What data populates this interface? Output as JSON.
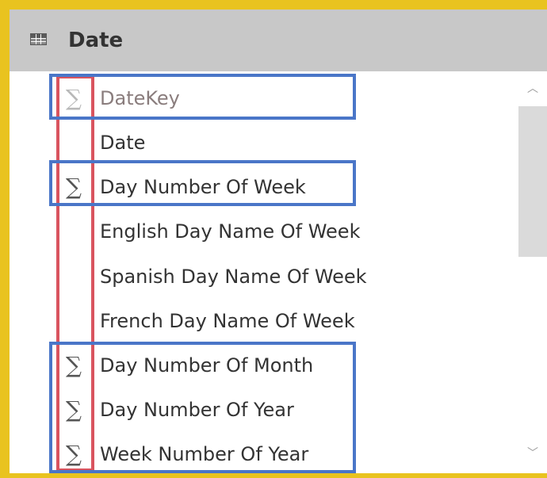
{
  "header": {
    "title": "Date",
    "icon": "table-icon"
  },
  "fields": [
    {
      "label": "DateKey",
      "sigma": "∑",
      "aggregatable": true,
      "hidden": true
    },
    {
      "label": "Date",
      "sigma": "",
      "aggregatable": false
    },
    {
      "label": "Day Number Of Week",
      "sigma": "∑",
      "aggregatable": true
    },
    {
      "label": "English Day Name Of Week",
      "sigma": "",
      "aggregatable": false
    },
    {
      "label": "Spanish Day Name Of Week",
      "sigma": "",
      "aggregatable": false
    },
    {
      "label": "French Day Name Of Week",
      "sigma": "",
      "aggregatable": false
    },
    {
      "label": "Day Number Of Month",
      "sigma": "∑",
      "aggregatable": true
    },
    {
      "label": "Day Number Of Year",
      "sigma": "∑",
      "aggregatable": true
    },
    {
      "label": "Week Number Of Year",
      "sigma": "∑",
      "aggregatable": true
    }
  ],
  "scrollbar": {
    "up_glyph": "︿",
    "down_glyph": "﹀"
  },
  "colors": {
    "frame": "#e9c31f",
    "header_bg": "#c8c8c8",
    "highlight_red": "#d9545f",
    "highlight_blue": "#4a76c8"
  }
}
